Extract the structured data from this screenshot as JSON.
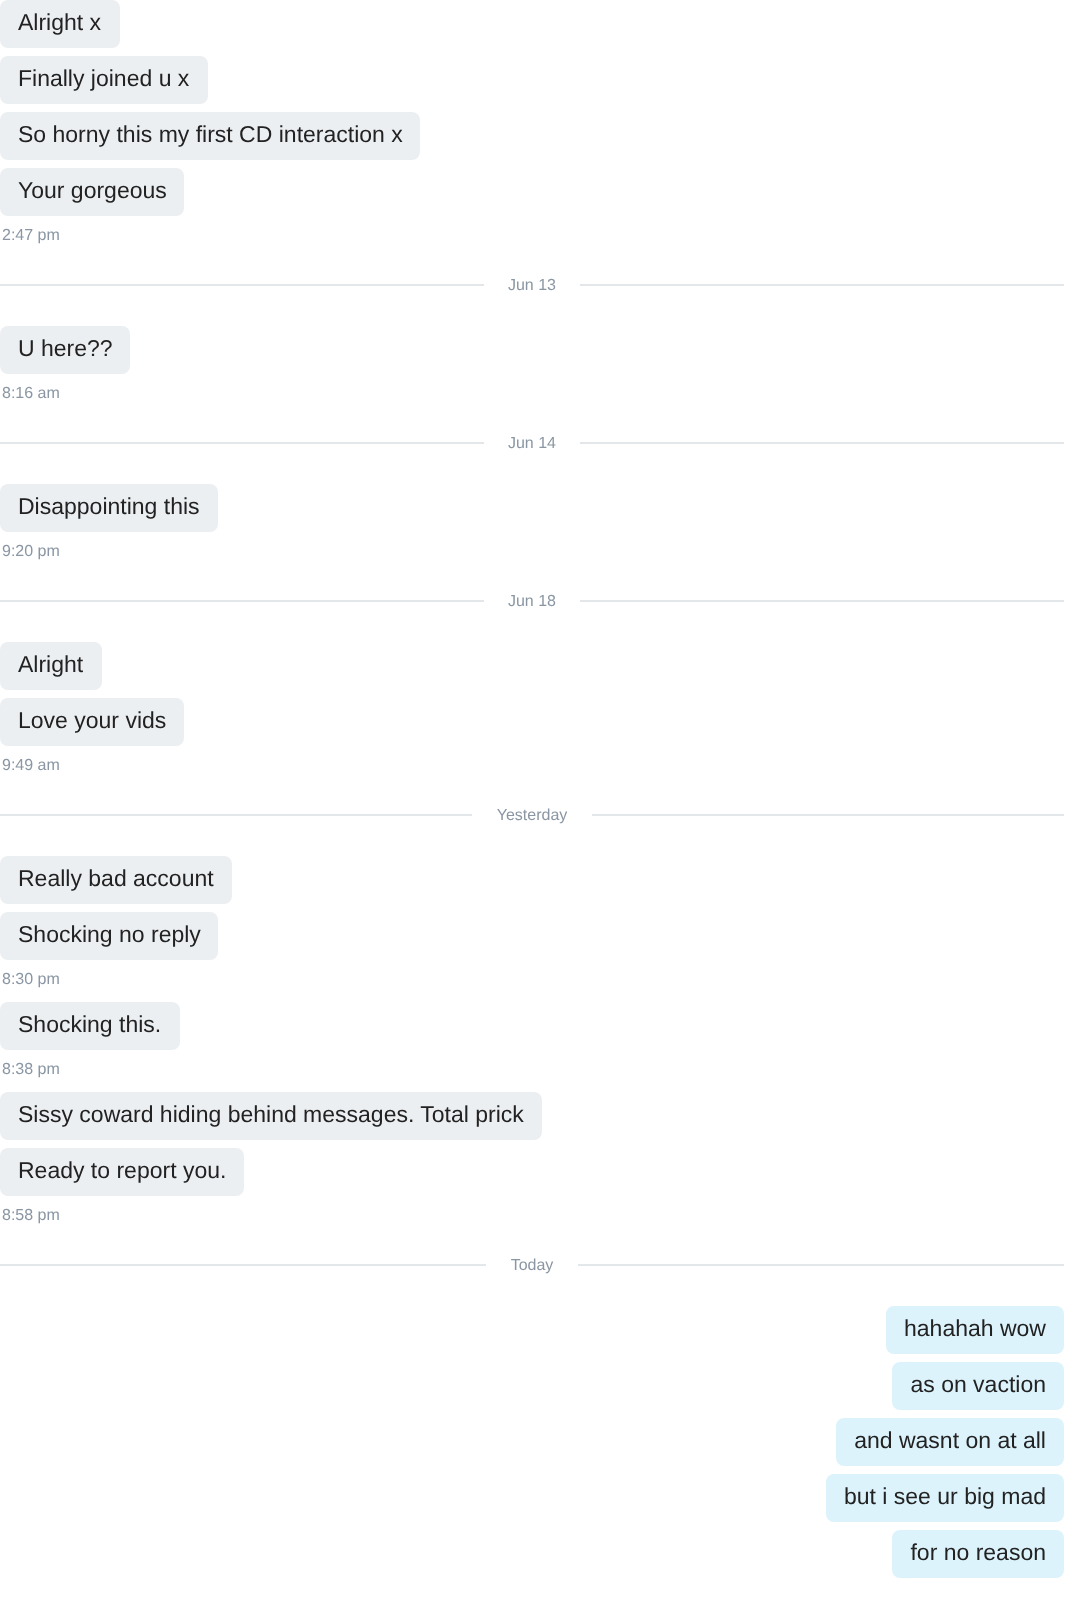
{
  "messages": [
    {
      "kind": "message",
      "outgoing": false,
      "text": "Alright x"
    },
    {
      "kind": "message",
      "outgoing": false,
      "text": "Finally joined u x"
    },
    {
      "kind": "message",
      "outgoing": false,
      "text": "So horny this my first CD interaction x"
    },
    {
      "kind": "message",
      "outgoing": false,
      "text": "Your gorgeous"
    },
    {
      "kind": "time",
      "text": "2:47 pm"
    },
    {
      "kind": "date",
      "text": "Jun 13"
    },
    {
      "kind": "message",
      "outgoing": false,
      "text": "U here??"
    },
    {
      "kind": "time",
      "text": "8:16 am"
    },
    {
      "kind": "date",
      "text": "Jun 14"
    },
    {
      "kind": "message",
      "outgoing": false,
      "text": "Disappointing this"
    },
    {
      "kind": "time",
      "text": "9:20 pm"
    },
    {
      "kind": "date",
      "text": "Jun 18"
    },
    {
      "kind": "message",
      "outgoing": false,
      "text": "Alright"
    },
    {
      "kind": "message",
      "outgoing": false,
      "text": "Love your vids"
    },
    {
      "kind": "time",
      "text": "9:49 am"
    },
    {
      "kind": "date",
      "text": "Yesterday"
    },
    {
      "kind": "message",
      "outgoing": false,
      "text": "Really bad account"
    },
    {
      "kind": "message",
      "outgoing": false,
      "text": "Shocking no reply"
    },
    {
      "kind": "time",
      "text": "8:30 pm"
    },
    {
      "kind": "message",
      "outgoing": false,
      "text": "Shocking this."
    },
    {
      "kind": "time",
      "text": "8:38 pm"
    },
    {
      "kind": "message",
      "outgoing": false,
      "text": "Sissy coward hiding behind messages. Total prick"
    },
    {
      "kind": "message",
      "outgoing": false,
      "text": "Ready to report you."
    },
    {
      "kind": "time",
      "text": "8:58 pm"
    },
    {
      "kind": "date",
      "text": "Today"
    },
    {
      "kind": "message",
      "outgoing": true,
      "text": "hahahah wow"
    },
    {
      "kind": "message",
      "outgoing": true,
      "text": "as on vaction"
    },
    {
      "kind": "message",
      "outgoing": true,
      "text": "and wasnt on at all"
    },
    {
      "kind": "message",
      "outgoing": true,
      "text": "but i see ur big mad"
    },
    {
      "kind": "message",
      "outgoing": true,
      "text": "for no reason"
    }
  ]
}
